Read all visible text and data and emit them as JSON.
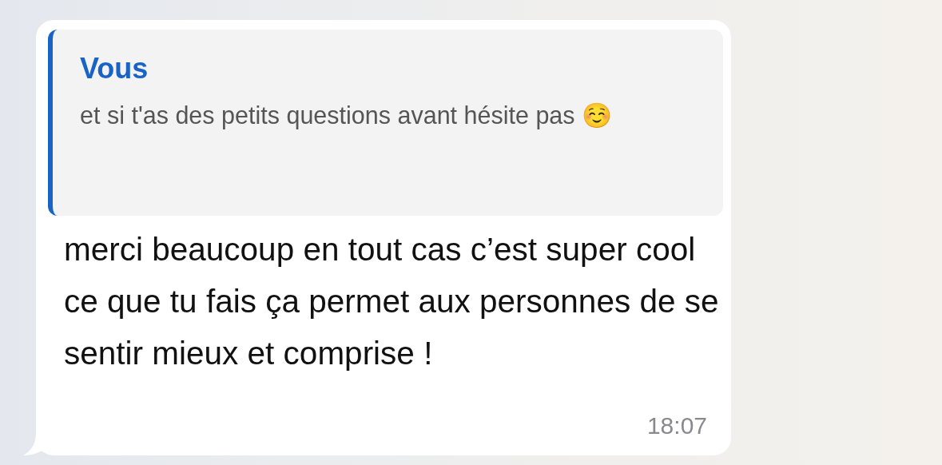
{
  "message": {
    "reply_to": {
      "author": "Vous",
      "text": "et si t'as des petits questions avant hésite pas ☺️"
    },
    "text": "merci beaucoup en tout cas c’est super cool ce que tu fais ça permet aux personnes de se sentir mieux et comprise !",
    "time": "18:07"
  }
}
